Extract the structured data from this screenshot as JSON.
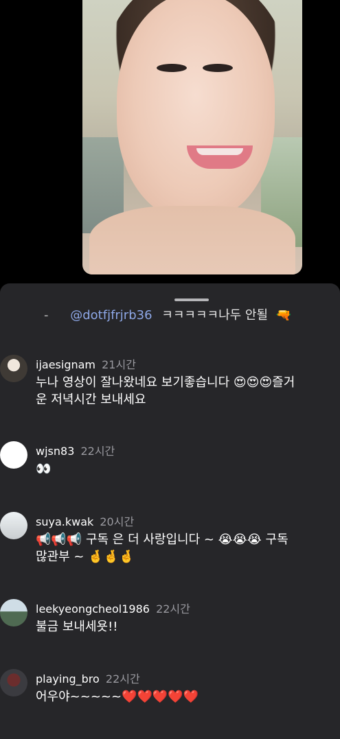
{
  "video": {
    "description_icon": "portrait-video-icon"
  },
  "sheet": {
    "partial_comment": {
      "dash": "-",
      "mention": "@dotfjfrjrb36",
      "text": "ㅋㅋㅋㅋㅋ나두 안될",
      "emoji": "🔫"
    },
    "comments": [
      {
        "username": "ijaesignam",
        "time": "21시간",
        "line1": "누나 영상이 잘나왔네요 보기좋습니다 😍😍😍즐거",
        "line2": "운 저녁시간 보내세요"
      },
      {
        "username": "wjsn83",
        "time": "22시간",
        "line1": "👀",
        "line2": ""
      },
      {
        "username": "suya.kwak",
        "time": "20시간",
        "line1": "📢📢📢 구독 은 더 사랑입니다 ~ 😭😭😭 구독",
        "line2": "많관부 ~ 🤞🤞🤞"
      },
      {
        "username": "leekyeongcheol1986",
        "time": "22시간",
        "line1": "불금 보내세욧!!",
        "line2": ""
      },
      {
        "username": "playing_bro",
        "time": "22시간",
        "line1": "어우야~~~~~❤️❤️❤️❤️❤️",
        "line2": ""
      }
    ]
  }
}
